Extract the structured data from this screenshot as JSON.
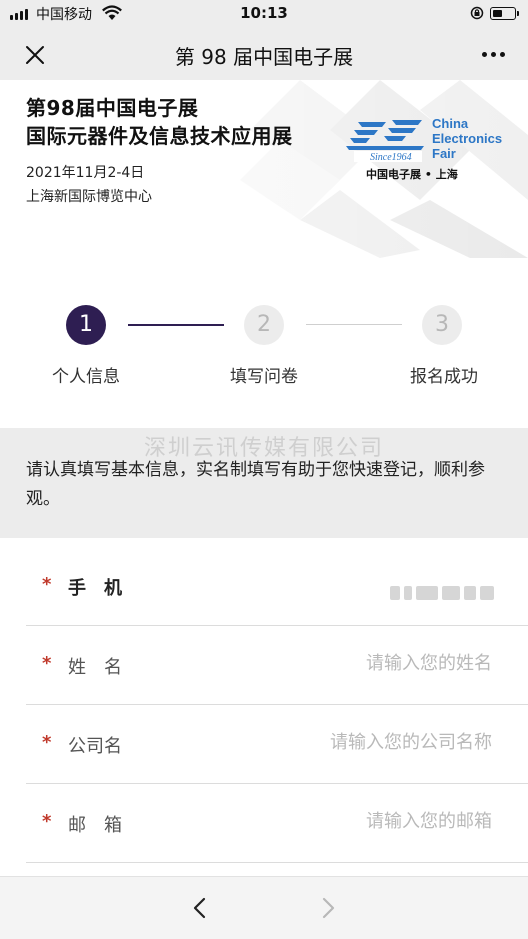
{
  "status_bar": {
    "carrier": "中国移动",
    "time": "10:13"
  },
  "nav": {
    "title": "第 98 届中国电子展"
  },
  "banner": {
    "title_line1": "第98届中国电子展",
    "title_line2": "国际元器件及信息技术应用展",
    "date": "2021年11月2-4日",
    "venue": "上海新国际博览中心",
    "logo_en_line1": "China",
    "logo_en_line2": "Electronics",
    "logo_en_line3": "Fair",
    "logo_since": "Since1964",
    "logo_cn": "中国电子展 • 上海"
  },
  "steps": [
    {
      "number": "1",
      "label": "个人信息",
      "active": true
    },
    {
      "number": "2",
      "label": "填写问卷",
      "active": false
    },
    {
      "number": "3",
      "label": "报名成功",
      "active": false
    }
  ],
  "notice": {
    "watermark": "深圳云讯传媒有限公司",
    "text": "请认真填写基本信息，实名制填写有助于您快速登记，顺利参观。"
  },
  "form": {
    "phone": {
      "label": "手　机",
      "required": "*"
    },
    "name": {
      "label": "姓　名",
      "required": "*",
      "placeholder": "请输入您的姓名"
    },
    "company": {
      "label": "公司名",
      "required": "*",
      "placeholder": "请输入您的公司名称"
    },
    "email": {
      "label": "邮　箱",
      "required": "*",
      "placeholder": "请输入您的邮箱"
    }
  },
  "colors": {
    "accent": "#2e1e52",
    "required": "#c0392b",
    "logo_blue": "#2d77c6"
  }
}
